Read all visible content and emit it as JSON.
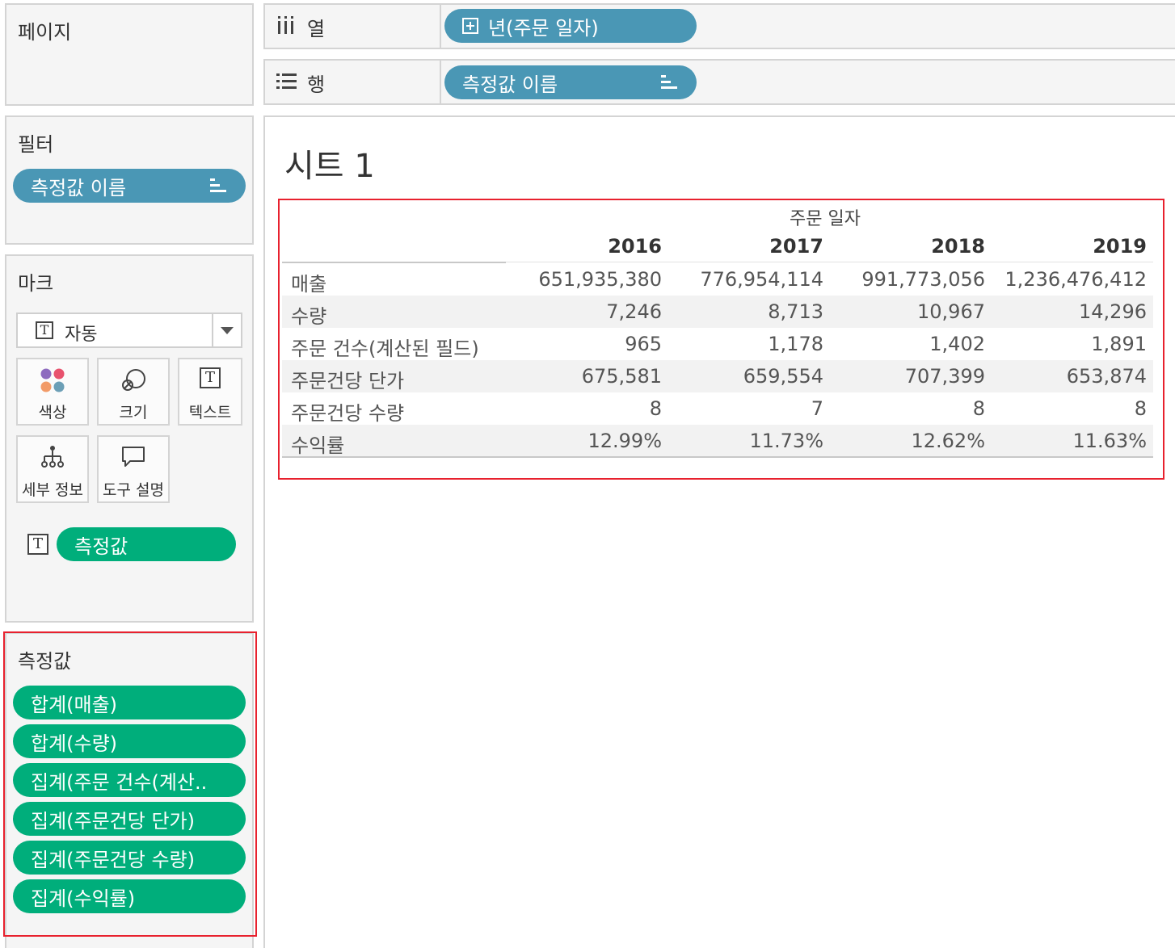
{
  "pages": {
    "title": "페이지"
  },
  "filters": {
    "title": "필터",
    "pill": "측정값 이름"
  },
  "marks": {
    "title": "마크",
    "type_dropdown": "자동",
    "buttons": {
      "color": "색상",
      "size": "크기",
      "text": "텍스트",
      "detail": "세부 정보",
      "tooltip": "도구 설명"
    },
    "text_pill": "측정값"
  },
  "measure_values": {
    "title": "측정값",
    "items": [
      "합계(매출)",
      "합계(수량)",
      "집계(주문 건수(계산..",
      "집계(주문건당 단가)",
      "집계(주문건당 수량)",
      "집계(수익률)"
    ]
  },
  "shelves": {
    "columns": {
      "label": "열",
      "pill": "년(주문 일자)"
    },
    "rows": {
      "label": "행",
      "pill": "측정값 이름"
    }
  },
  "sheet": {
    "title": "시트 1"
  },
  "table": {
    "column_header": "주문 일자",
    "years": [
      "2016",
      "2017",
      "2018",
      "2019"
    ],
    "rows": [
      {
        "name": "매출",
        "values": [
          "651,935,380",
          "776,954,114",
          "991,773,056",
          "1,236,476,412"
        ]
      },
      {
        "name": "수량",
        "values": [
          "7,246",
          "8,713",
          "10,967",
          "14,296"
        ]
      },
      {
        "name": "주문 건수(계산된 필드)",
        "values": [
          "965",
          "1,178",
          "1,402",
          "1,891"
        ]
      },
      {
        "name": "주문건당 단가",
        "values": [
          "675,581",
          "659,554",
          "707,399",
          "653,874"
        ]
      },
      {
        "name": "주문건당 수량",
        "values": [
          "8",
          "7",
          "8",
          "8"
        ]
      },
      {
        "name": "수익률",
        "values": [
          "12.99%",
          "11.73%",
          "12.62%",
          "11.63%"
        ]
      }
    ]
  },
  "colors": {
    "blue_pill": "#4a97b5",
    "green_pill": "#00ae7b",
    "highlight": "#e8212e"
  }
}
